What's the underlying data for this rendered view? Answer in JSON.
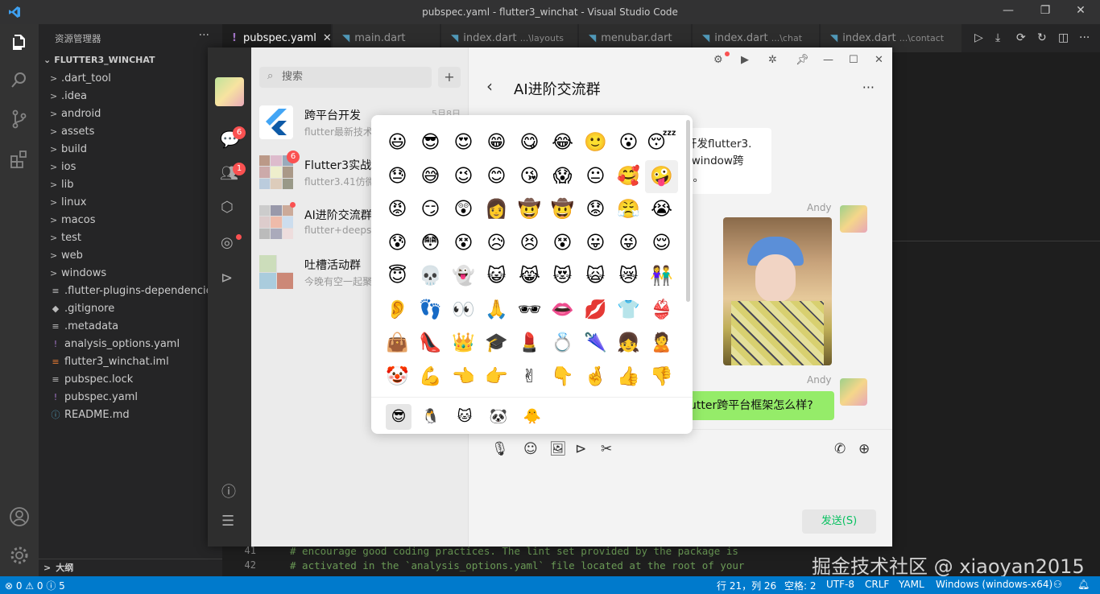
{
  "window": {
    "title": "pubspec.yaml - flutter3_winchat - Visual Studio Code"
  },
  "explorer": {
    "header": "资源管理器",
    "more": "···",
    "root": "FLUTTER3_WINCHAT",
    "items": [
      {
        "chev": ">",
        "label": ".dart_tool"
      },
      {
        "chev": ">",
        "label": ".idea"
      },
      {
        "chev": ">",
        "label": "android"
      },
      {
        "chev": ">",
        "label": "assets"
      },
      {
        "chev": ">",
        "label": "build"
      },
      {
        "chev": ">",
        "label": "ios"
      },
      {
        "chev": ">",
        "label": "lib"
      },
      {
        "chev": ">",
        "label": "linux"
      },
      {
        "chev": ">",
        "label": "macos"
      },
      {
        "chev": ">",
        "label": "test"
      },
      {
        "chev": ">",
        "label": "web"
      },
      {
        "chev": ">",
        "label": "windows"
      },
      {
        "icon": "≡",
        "label": ".flutter-plugins-dependencies"
      },
      {
        "icon": "◆",
        "label": ".gitignore"
      },
      {
        "icon": "≡",
        "label": ".metadata"
      },
      {
        "icon": "!",
        "label": "analysis_options.yaml"
      },
      {
        "icon": "≡",
        "label": "flutter3_winchat.iml"
      },
      {
        "icon": "≡",
        "label": "pubspec.lock"
      },
      {
        "icon": "!",
        "label": "pubspec.yaml"
      },
      {
        "icon": "ⓘ",
        "label": "README.md"
      }
    ],
    "outline": "大纲"
  },
  "tabs": [
    {
      "label": "pubspec.yaml",
      "sub": "",
      "icon": "!",
      "close": "✕"
    },
    {
      "label": "main.dart",
      "sub": ""
    },
    {
      "label": "index.dart",
      "sub": "...\\layouts"
    },
    {
      "label": "menubar.dart",
      "sub": ""
    },
    {
      "label": "index.dart",
      "sub": "...\\chat"
    },
    {
      "label": "index.dart",
      "sub": "...\\contact"
    }
  ],
  "editor": {
    "lines": [
      {
        "no": "41",
        "text": "# encourage good coding practices. The lint set provided by the package is"
      },
      {
        "no": "42",
        "text": "# activated in the `analysis_options.yaml` file located at the root of your"
      }
    ]
  },
  "statusbar": {
    "problems": "⊗ 0 ⚠ 0 ⓘ 5",
    "position": "行 21，列 26",
    "spaces": "空格: 2",
    "encoding": "UTF-8",
    "eol": "CRLF",
    "language": "YAML",
    "platform": "Windows (windows-x64)"
  },
  "watermark": "掘金技术社区 @ xiaoyan2015",
  "app": {
    "badges": {
      "chat": "6",
      "contacts": "1"
    },
    "search_placeholder": "搜索",
    "plus": "+",
    "conversations": [
      {
        "name": "跨平台开发",
        "msg": "flutter最新技术",
        "date": "5月8日"
      },
      {
        "name": "Flutter3实战",
        "msg": "flutter3.41仿微",
        "badge": "6"
      },
      {
        "name": "AI进阶交流群",
        "msg": "flutter+deepse"
      },
      {
        "name": "吐槽活动群",
        "msg": "今晚有空一起聚"
      }
    ],
    "chat": {
      "title": "AI进阶交流群",
      "back": "‹",
      "more": "···",
      "left_bubble_lines": [
        "开发flutter3.",
        "_window跨",
        "E。"
      ],
      "sender1": "Andy",
      "sender2": "Andy",
      "green_bubble": "utter跨平台框架怎么样?",
      "send_button": "发送(S)"
    }
  },
  "emoji_panel": {
    "emojis": [
      "😃",
      "😎",
      "😍",
      "😁",
      "😋",
      "😂",
      "🙂",
      "😮",
      "😴",
      "😓",
      "😅",
      "😉",
      "😊",
      "😘",
      "😱",
      "😐",
      "🥰",
      "🤪",
      "😡",
      "😏",
      "😲",
      "👩",
      "🤠",
      "🤠",
      "😟",
      "😤",
      "😭",
      "😰",
      "😳",
      "😵",
      "😥",
      "😣",
      "😵",
      "😛",
      "😜",
      "😌",
      "😇",
      "💀",
      "👻",
      "😺",
      "😹",
      "😻",
      "🙀",
      "😿",
      "👫",
      "👂",
      "👣",
      "👀",
      "🙏",
      "🕶",
      "👄",
      "💋",
      "👕",
      "👙",
      "👜",
      "👠",
      "👑",
      "🎓",
      "💄",
      "💍",
      "🌂",
      "👧",
      "🙎",
      "🤡",
      "💪",
      "👈",
      "👉",
      "✌",
      "👇",
      "🤞",
      "👍",
      "👎"
    ],
    "tabs": [
      "😎",
      "🐧",
      "🐱",
      "🐼",
      "🐥"
    ]
  }
}
